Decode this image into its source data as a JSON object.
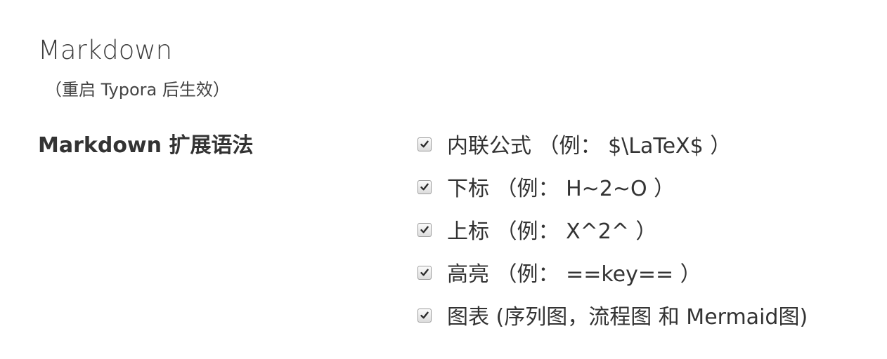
{
  "section": {
    "title": "Markdown",
    "subtitle": "（重启 Typora 后生效）"
  },
  "setting": {
    "label": "Markdown 扩展语法",
    "options": [
      {
        "label": "内联公式 （例： $\\LaTeX$ ）",
        "checked": true
      },
      {
        "label": "下标 （例： H~2~O ）",
        "checked": true
      },
      {
        "label": "上标 （例： X^2^ ）",
        "checked": true
      },
      {
        "label": "高亮 （例： ==key== ）",
        "checked": true
      },
      {
        "label": "图表 (序列图，流程图 和 Mermaid图)",
        "checked": true
      }
    ]
  },
  "icons": {
    "checkbox_checked": "checkmark-icon"
  },
  "colors": {
    "text": "#333333",
    "checkbox_border": "#9a9a9a",
    "checkmark": "#2b2b2b"
  }
}
